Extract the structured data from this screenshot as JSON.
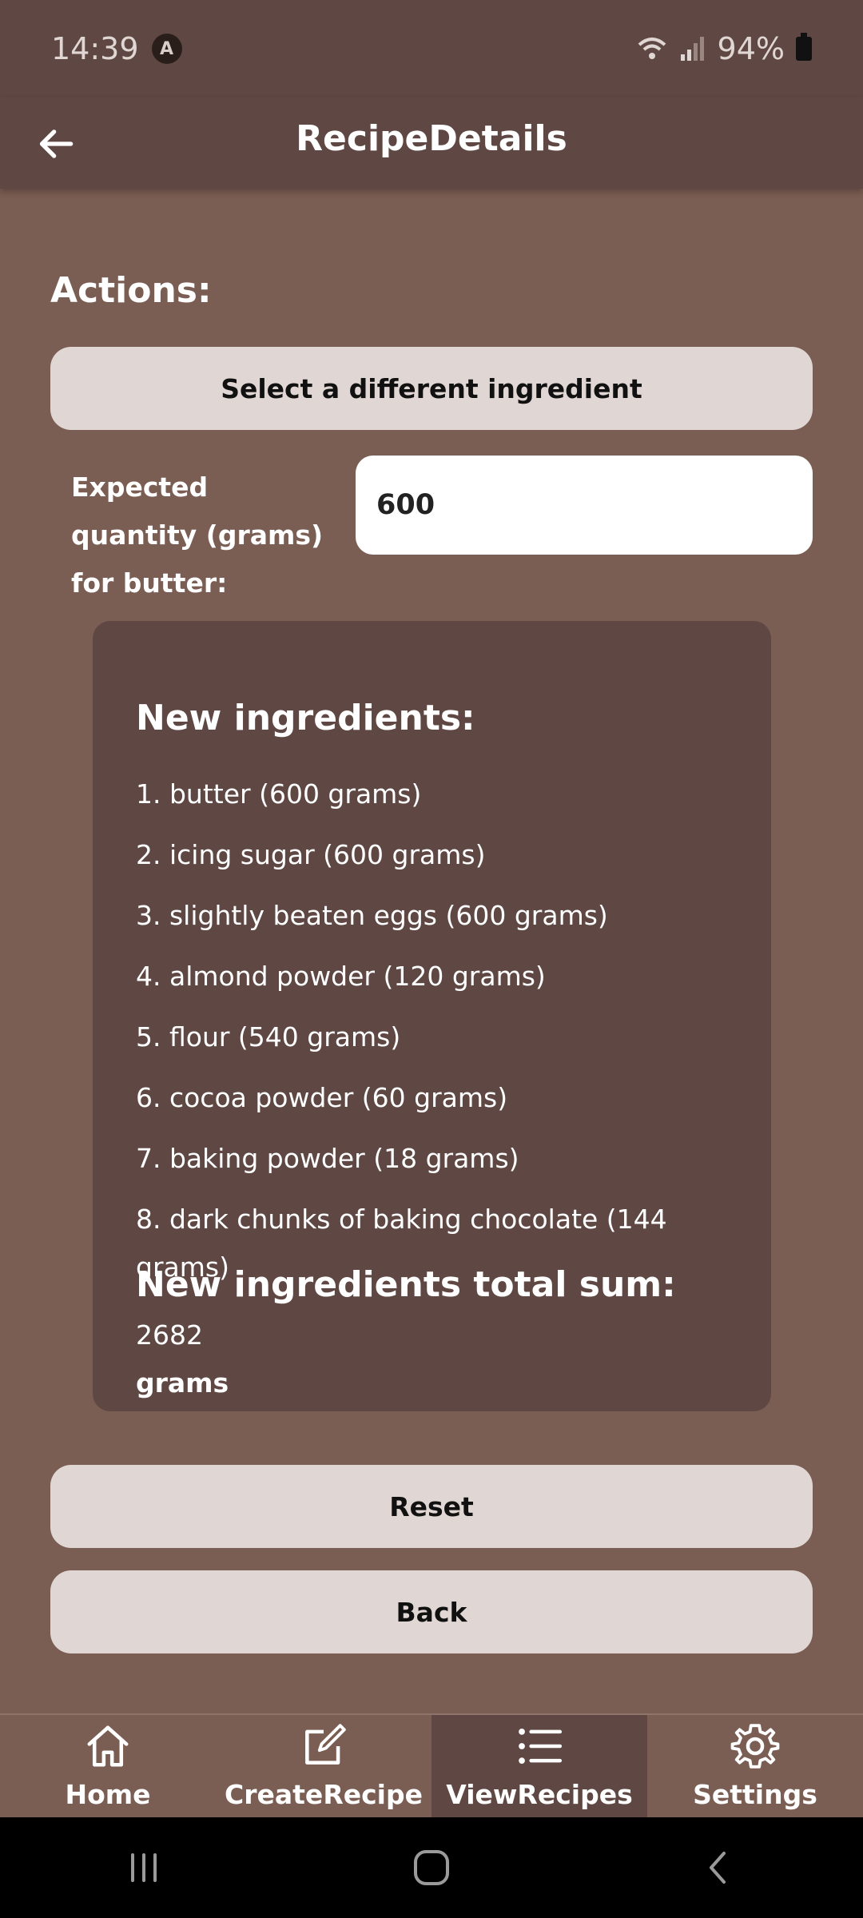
{
  "status_bar": {
    "time": "14:39",
    "battery": "94%",
    "icons": [
      "wifi-icon",
      "signal-icon",
      "battery-icon"
    ]
  },
  "app_bar": {
    "title": "RecipeDetails"
  },
  "actions": {
    "label": "Actions:",
    "select_ingredient_button": "Select a different ingredient",
    "quantity_label": "Expected quantity (grams) for butter:",
    "quantity_value": "600"
  },
  "new_ingredients": {
    "title": "New ingredients:",
    "items": [
      "1. butter (600 grams)",
      "2. icing sugar (600 grams)",
      "3. slightly beaten eggs (600 grams)",
      "4. almond powder (120 grams)",
      "5. flour (540 grams)",
      "6. cocoa powder (60 grams)",
      "7. baking powder (18 grams)",
      "8. dark chunks of baking chocolate (144 grams)"
    ],
    "total_label": "New ingredients total sum:",
    "total_value": "2682",
    "total_unit": "grams"
  },
  "buttons": {
    "reset": "Reset",
    "back": "Back"
  },
  "bottom_nav": {
    "items": [
      {
        "label": "Home",
        "icon": "home-icon"
      },
      {
        "label": "CreateRecipe",
        "icon": "edit-icon"
      },
      {
        "label": "ViewRecipes",
        "icon": "list-icon",
        "active": true
      },
      {
        "label": "Settings",
        "icon": "gear-icon"
      }
    ]
  },
  "colors": {
    "background": "#7a5d53",
    "bar": "#5f4843",
    "button": "#e0d6d3"
  }
}
